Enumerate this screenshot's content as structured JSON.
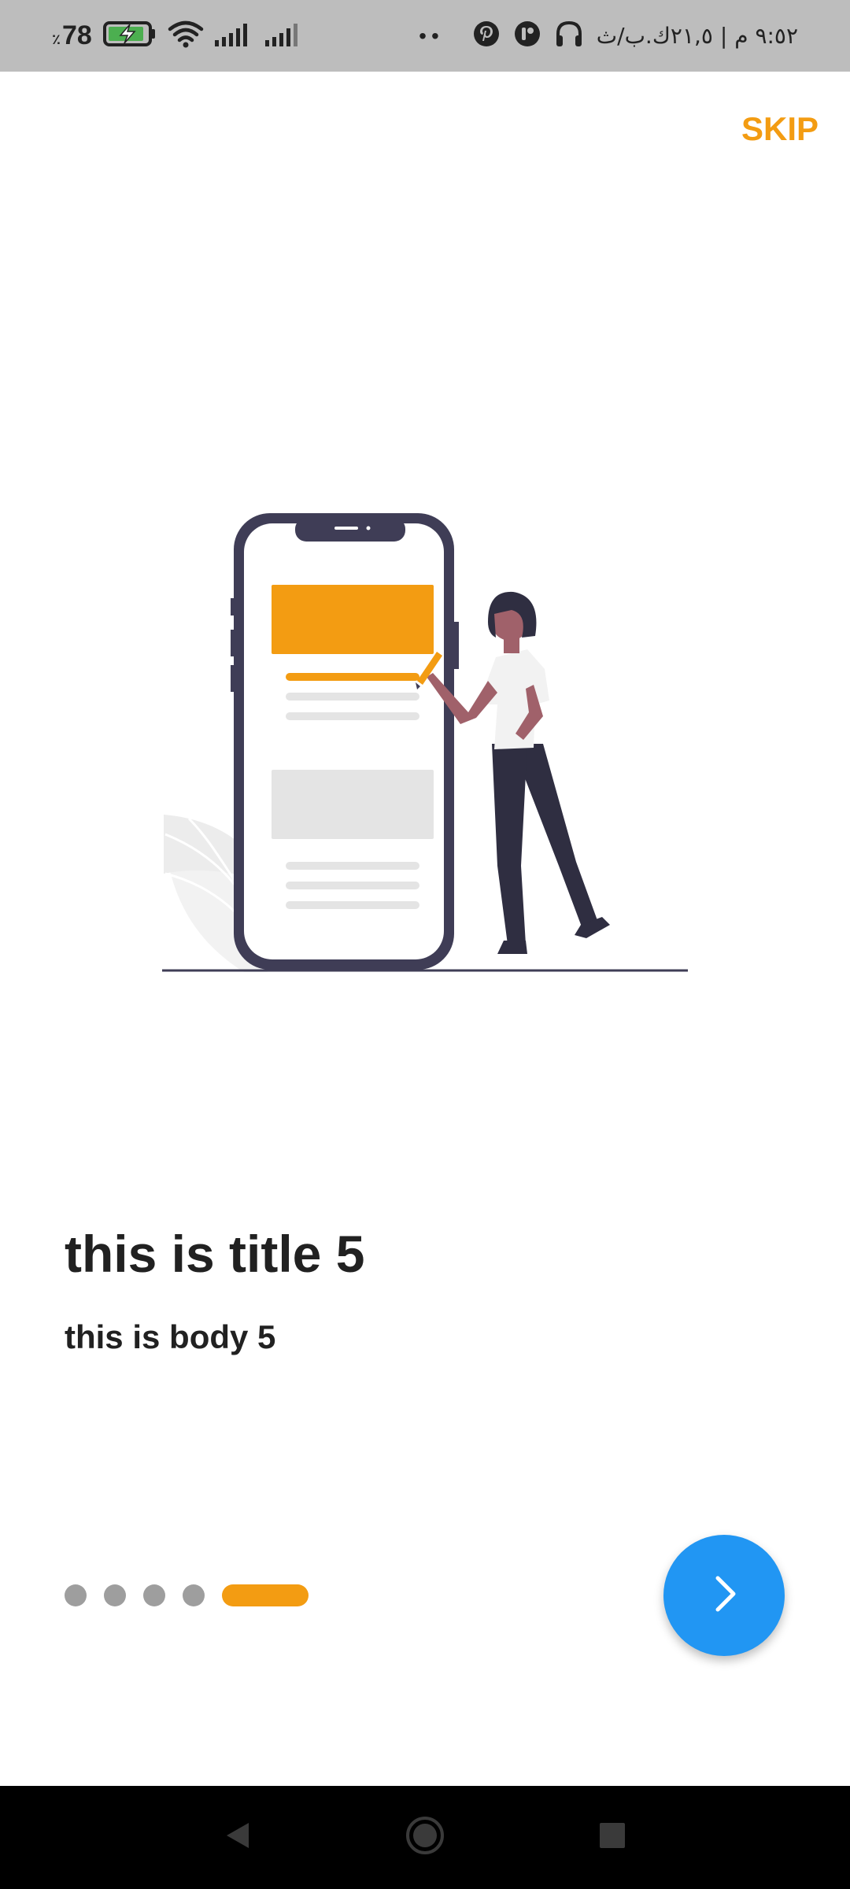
{
  "status_bar": {
    "battery_level": "78",
    "battery_percent_sign": "٪",
    "time_text": "٩:٥٢ م | ٢١,٥ك.ب/ث",
    "dots": "••",
    "icons": [
      "battery-charging-icon",
      "wifi-icon",
      "signal-icon",
      "signal-icon",
      "pinterest-icon",
      "app-icon",
      "headphones-icon"
    ]
  },
  "header": {
    "skip_label": "SKIP"
  },
  "content": {
    "title": "this is title 5",
    "body": "this is body 5"
  },
  "pager": {
    "page_count": 5,
    "current_page": 5
  },
  "colors": {
    "accent": "#f39c12",
    "fab": "#2196f3",
    "inactive_dot": "#9e9e9e",
    "status_bar": "#bdbdbd",
    "text": "#212121"
  },
  "fab": {
    "icon": "chevron-right-icon"
  },
  "nav_bar": {
    "buttons": [
      "back-icon",
      "home-icon",
      "recents-icon"
    ]
  }
}
